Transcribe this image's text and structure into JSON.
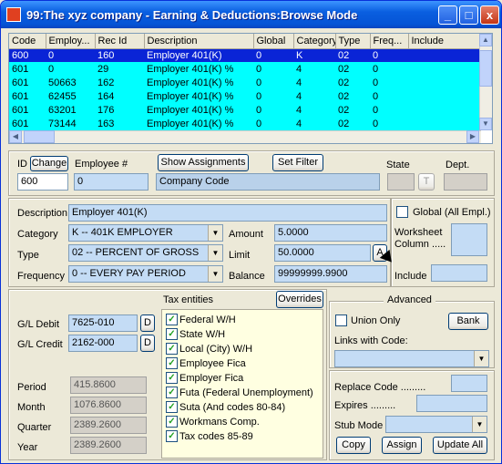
{
  "window": {
    "title": "99:The xyz company - Earning & Deductions:Browse Mode",
    "buttons": {
      "minimize": "_",
      "maximize": "□",
      "close": "x"
    }
  },
  "grid": {
    "columns": [
      "Code",
      "Employ...",
      "Rec Id",
      "Description",
      "Global",
      "Category",
      "Type",
      "Freq...",
      "Include"
    ],
    "rows": [
      [
        "600",
        "0",
        "160",
        "Employer 401(K)",
        "0",
        "K",
        "02",
        "0",
        ""
      ],
      [
        "601",
        "0",
        "29",
        "Employer 401(K) %",
        "0",
        "4",
        "02",
        "0",
        ""
      ],
      [
        "601",
        "50663",
        "162",
        "Employer 401(K) %",
        "0",
        "4",
        "02",
        "0",
        ""
      ],
      [
        "601",
        "62455",
        "164",
        "Employer 401(K) %",
        "0",
        "4",
        "02",
        "0",
        ""
      ],
      [
        "601",
        "63201",
        "176",
        "Employer 401(K) %",
        "0",
        "4",
        "02",
        "0",
        ""
      ],
      [
        "601",
        "73144",
        "163",
        "Employer 401(K) %",
        "0",
        "4",
        "02",
        "0",
        ""
      ]
    ]
  },
  "top": {
    "id_label": "ID",
    "change_label": "Change",
    "employee_label": "Employee #",
    "show_assignments": "Show Assignments",
    "set_filter": "Set Filter",
    "state_label": "State",
    "dept_label": "Dept.",
    "id_value": "600",
    "employee_value": "0",
    "company_code": "Company Code",
    "state_btn": "T"
  },
  "details": {
    "description_label": "Description",
    "description_value": "Employer 401(K)",
    "category_label": "Category",
    "category_value": "K -- 401K EMPLOYER",
    "type_label": "Type",
    "type_value": "02 -- PERCENT OF GROSS",
    "frequency_label": "Frequency",
    "frequency_value": "0 -- EVERY PAY PERIOD",
    "amount_label": "Amount",
    "amount_value": "5.0000",
    "limit_label": "Limit",
    "limit_value": "50.0000",
    "limit_btn": "A",
    "balance_label": "Balance",
    "balance_value": "99999999.9900",
    "global_label": "Global (All Empl.)",
    "worksheet_label": "Worksheet Column .....",
    "include_label": "Include"
  },
  "gl": {
    "debit_label": "G/L Debit",
    "debit_value": "7625-010",
    "debit_btn": "D",
    "credit_label": "G/L Credit",
    "credit_value": "2162-000",
    "credit_btn": "D",
    "period_label": "Period",
    "period_value": "415.8600",
    "month_label": "Month",
    "month_value": "1076.8600",
    "quarter_label": "Quarter",
    "quarter_value": "2389.2600",
    "year_label": "Year",
    "year_value": "2389.2600"
  },
  "tax": {
    "label": "Tax entities",
    "overrides": "Overrides",
    "items": [
      "Federal W/H",
      "State W/H",
      "Local (City) W/H",
      "Employee Fica",
      "Employer Fica",
      "Futa (Federal Unemployment)",
      "Suta (And codes 80-84)",
      "Workmans Comp.",
      "Tax codes 85-89"
    ]
  },
  "advanced": {
    "label": "Advanced",
    "union_only": "Union Only",
    "bank": "Bank",
    "links_label": "Links with Code:",
    "replace_label": "Replace Code .........",
    "expires_label": "Expires .........",
    "stub_label": "Stub Mode",
    "copy": "Copy",
    "assign": "Assign",
    "update_all": "Update All"
  }
}
